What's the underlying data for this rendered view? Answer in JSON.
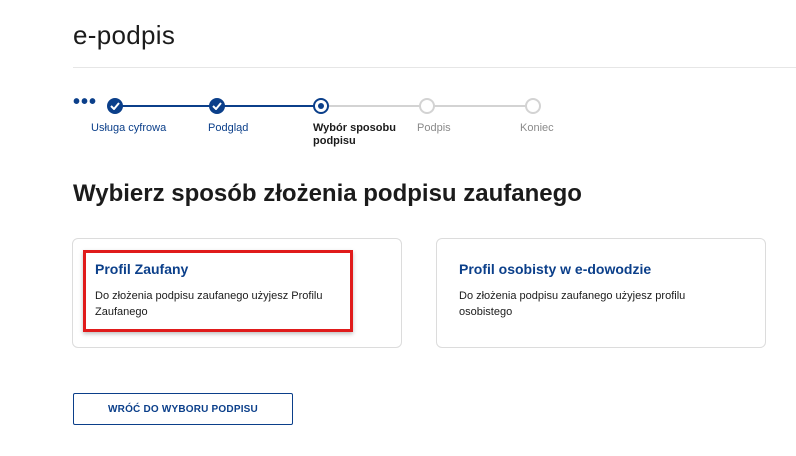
{
  "app": {
    "title": "e-podpis"
  },
  "stepper": {
    "more_label": "•••",
    "steps": [
      {
        "label": "Usługa cyfrowa",
        "status": "done"
      },
      {
        "label": "Podgląd",
        "status": "done"
      },
      {
        "label": "Wybór sposobu podpisu",
        "status": "current"
      },
      {
        "label": "Podpis",
        "status": "todo"
      },
      {
        "label": "Koniec",
        "status": "todo"
      }
    ]
  },
  "main": {
    "heading": "Wybierz sposób złożenia podpisu zaufanego",
    "options": [
      {
        "title": "Profil Zaufany",
        "description": "Do złożenia podpisu zaufanego użyjesz Profilu Zaufanego",
        "highlighted": true
      },
      {
        "title": "Profil osobisty w e-dowodzie",
        "description": "Do złożenia podpisu zaufanego użyjesz profilu osobistego",
        "highlighted": false
      }
    ],
    "back_button": "WRÓĆ DO WYBORU PODPISU"
  },
  "colors": {
    "primary": "#0b3f8a",
    "highlight": "#e01b1b",
    "inactive": "#d3d3d3"
  }
}
